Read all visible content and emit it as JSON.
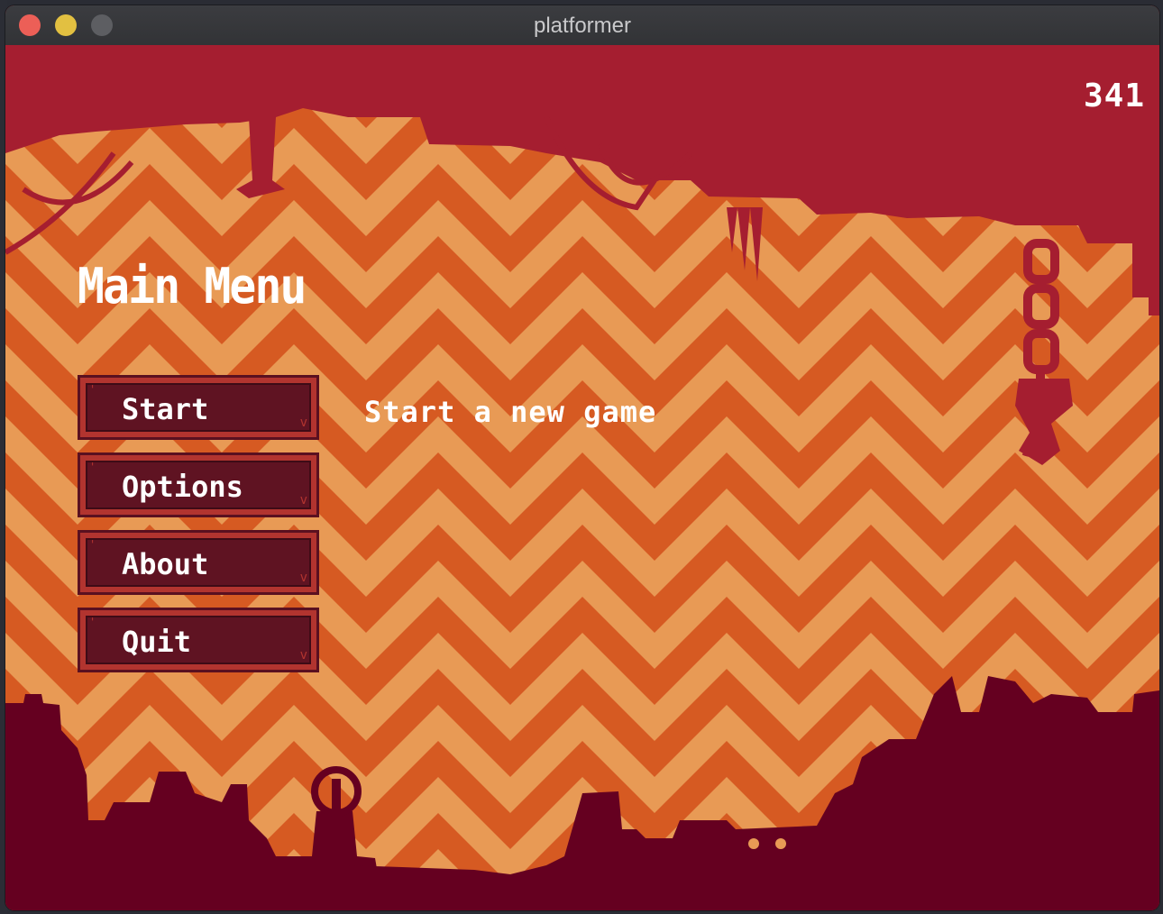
{
  "window": {
    "title": "platformer"
  },
  "hud": {
    "fps_counter": "341"
  },
  "menu": {
    "title": "Main Menu",
    "buttons": [
      {
        "label": "Start"
      },
      {
        "label": "Options"
      },
      {
        "label": "About"
      },
      {
        "label": "Quit"
      }
    ],
    "description": "Start a new game"
  },
  "colors": {
    "sky": "#a51e30",
    "chevron_dark": "#d65a22",
    "chevron_light": "#e89a55",
    "silhouette": "#650020",
    "button_face": "#5f1322",
    "button_border": "#b2342f"
  }
}
